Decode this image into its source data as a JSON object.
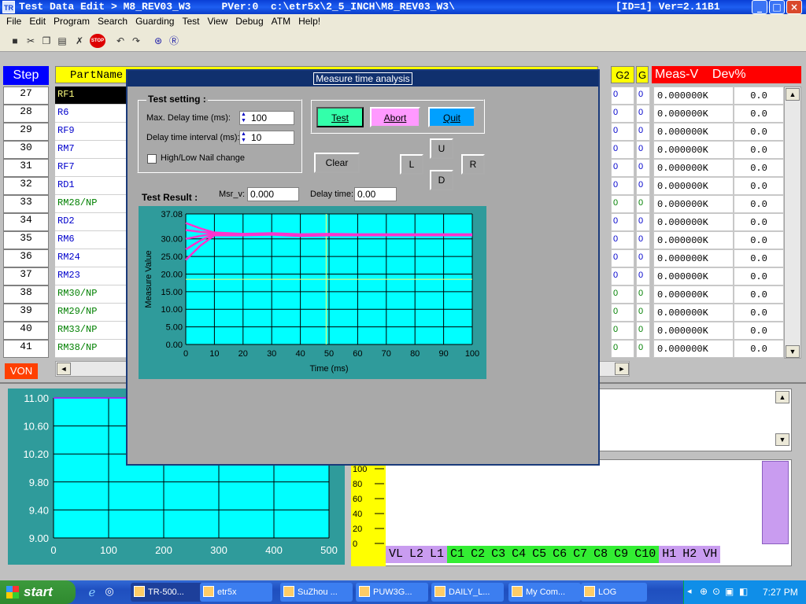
{
  "window": {
    "title": "Test Data Edit > M8_REV03_W3     PVer:0  c:\\etr5x\\2_5_INCH\\M8_REV03_W3\\",
    "title_right": "[ID=1] Ver=2.11B1",
    "app_icon": "TR"
  },
  "menu": [
    "File",
    "Edit",
    "Program",
    "Search",
    "Guarding",
    "Test",
    "View",
    "Debug",
    "ATM",
    "Help!"
  ],
  "toolbar": {
    "stop_label": "STOP"
  },
  "grid": {
    "header_step": "Step",
    "header_part": "PartName",
    "header_g2": "G2",
    "header_g": "G",
    "header_meas": "Meas-V    Dev%",
    "steps": [
      "27",
      "28",
      "29",
      "30",
      "31",
      "32",
      "33",
      "34",
      "35",
      "36",
      "37",
      "38",
      "39",
      "40",
      "41"
    ],
    "parts": [
      "RF1",
      "R6",
      "RF9",
      "RM7",
      "RF7",
      "RD1",
      "RM28/NP",
      "RD2",
      "RM6",
      "RM24",
      "RM23",
      "RM30/NP",
      "RM29/NP",
      "RM33/NP",
      "RM38/NP"
    ],
    "g2": [
      "0",
      "0",
      "0",
      "0",
      "0",
      "0",
      "0",
      "0",
      "0",
      "0",
      "0",
      "0",
      "0",
      "0",
      "0"
    ],
    "g": [
      "0",
      "0",
      "0",
      "0",
      "0",
      "0",
      "0",
      "0",
      "0",
      "0",
      "0",
      "0",
      "0",
      "0",
      "0"
    ],
    "meas": [
      "0.000000K",
      "0.000000K",
      "0.000000K",
      "0.000000K",
      "0.000000K",
      "0.000000K",
      "0.000000K",
      "0.000000K",
      "0.000000K",
      "0.000000K",
      "0.000000K",
      "0.000000K",
      "0.000000K",
      "0.000000K",
      "0.000000K"
    ],
    "dev": [
      "0.0",
      "0.0",
      "0.0",
      "0.0",
      "0.0",
      "0.0",
      "0.0",
      "0.0",
      "0.0",
      "0.0",
      "0.0",
      "0.0",
      "0.0",
      "0.0",
      "0.0"
    ],
    "selected_index": 0,
    "colors": {
      "black": "#0000cc",
      "green": "#008000"
    }
  },
  "von_label": "VON",
  "lower_chart": {
    "y_ticks": [
      "11.00",
      "10.60",
      "10.20",
      "9.80",
      "9.40",
      "9.00"
    ],
    "x_ticks": [
      "0",
      "100",
      "200",
      "300",
      "400",
      "500"
    ]
  },
  "yellow_scale": [
    "100",
    "80",
    "60",
    "40",
    "20",
    "0"
  ],
  "tags": [
    {
      "label": "VL",
      "group": "purple"
    },
    {
      "label": "L2",
      "group": "purple"
    },
    {
      "label": "L1",
      "group": "purple"
    },
    {
      "label": "C1",
      "group": "green"
    },
    {
      "label": "C2",
      "group": "green"
    },
    {
      "label": "C3",
      "group": "green"
    },
    {
      "label": "C4",
      "group": "green"
    },
    {
      "label": "C5",
      "group": "green"
    },
    {
      "label": "C6",
      "group": "green"
    },
    {
      "label": "C7",
      "group": "green"
    },
    {
      "label": "C8",
      "group": "green"
    },
    {
      "label": "C9",
      "group": "green"
    },
    {
      "label": "C10",
      "group": "green"
    },
    {
      "label": "H1",
      "group": "purple"
    },
    {
      "label": "H2",
      "group": "purple"
    },
    {
      "label": "VH",
      "group": "purple"
    }
  ],
  "dialog": {
    "title": "Measure time analysis",
    "test_setting_label": "Test setting :",
    "max_delay_label": "Max. Delay time (ms):",
    "max_delay_value": "100",
    "interval_label": "Delay time interval (ms):",
    "interval_value": "10",
    "nail_change_label": "High/Low Nail change",
    "nail_change_checked": false,
    "test_button": "Test",
    "abort_button": "Abort",
    "quit_button": "Quit",
    "clear_button": "Clear",
    "up_button": "U",
    "down_button": "D",
    "left_button": "L",
    "right_button": "R",
    "test_result_label": "Test Result :",
    "msr_v_label": "Msr_v:",
    "msr_v_value": "0.000",
    "delay_time_label": "Delay time:",
    "delay_time_value": "0.00"
  },
  "chart_data": {
    "type": "line",
    "ylabel": "Measure Value",
    "xlabel": "Time (ms)",
    "xlim": [
      0,
      100
    ],
    "ylim": [
      0,
      37.08
    ],
    "x_ticks": [
      0,
      10,
      20,
      30,
      40,
      50,
      60,
      70,
      80,
      90,
      100
    ],
    "y_ticks": [
      "0.00",
      "5.00",
      "10.00",
      "15.00",
      "20.00",
      "25.00",
      "30.00",
      "37.08"
    ],
    "grid": true,
    "series": [
      {
        "values_x": [
          0,
          5,
          10,
          20,
          30,
          40,
          50,
          60,
          70,
          80,
          90,
          100
        ],
        "values_y": [
          24.0,
          28.0,
          31.0,
          31.0,
          31.2,
          30.8,
          31.0,
          31.0,
          31.0,
          31.0,
          31.0,
          31.0
        ]
      },
      {
        "values_x": [
          0,
          5,
          10,
          20,
          30,
          40,
          50,
          60,
          70,
          80,
          90,
          100
        ],
        "values_y": [
          27.0,
          29.5,
          31.3,
          31.2,
          31.4,
          31.0,
          31.2,
          31.1,
          31.1,
          31.1,
          31.1,
          31.1
        ]
      },
      {
        "values_x": [
          0,
          5,
          10,
          20,
          30,
          40,
          50,
          60,
          70,
          80,
          90,
          100
        ],
        "values_y": [
          30.0,
          30.8,
          31.5,
          31.3,
          31.5,
          31.2,
          31.3,
          31.2,
          31.2,
          31.2,
          31.2,
          31.2
        ]
      },
      {
        "values_x": [
          0,
          5,
          10,
          20,
          30,
          40,
          50,
          60,
          70,
          80,
          90,
          100
        ],
        "values_y": [
          34.5,
          33.0,
          31.8,
          31.4,
          31.6,
          31.3,
          31.4,
          31.3,
          31.3,
          31.3,
          31.3,
          31.3
        ]
      },
      {
        "values_x": [
          0,
          5,
          10,
          20,
          30,
          40,
          50,
          60,
          70,
          80,
          90,
          100
        ],
        "values_y": [
          32.5,
          32.0,
          31.6,
          31.3,
          31.5,
          31.2,
          31.3,
          31.2,
          31.2,
          31.2,
          31.2,
          31.2
        ]
      }
    ],
    "marker_x": 49,
    "marker_y": 18.5
  },
  "taskbar": {
    "start_label": "start",
    "items": [
      "TR-500...",
      "etr5x",
      "SuZhou ...",
      "PUW3G...",
      "DAILY_L...",
      "My Com...",
      "LOG"
    ],
    "clock": "7:27 PM"
  }
}
